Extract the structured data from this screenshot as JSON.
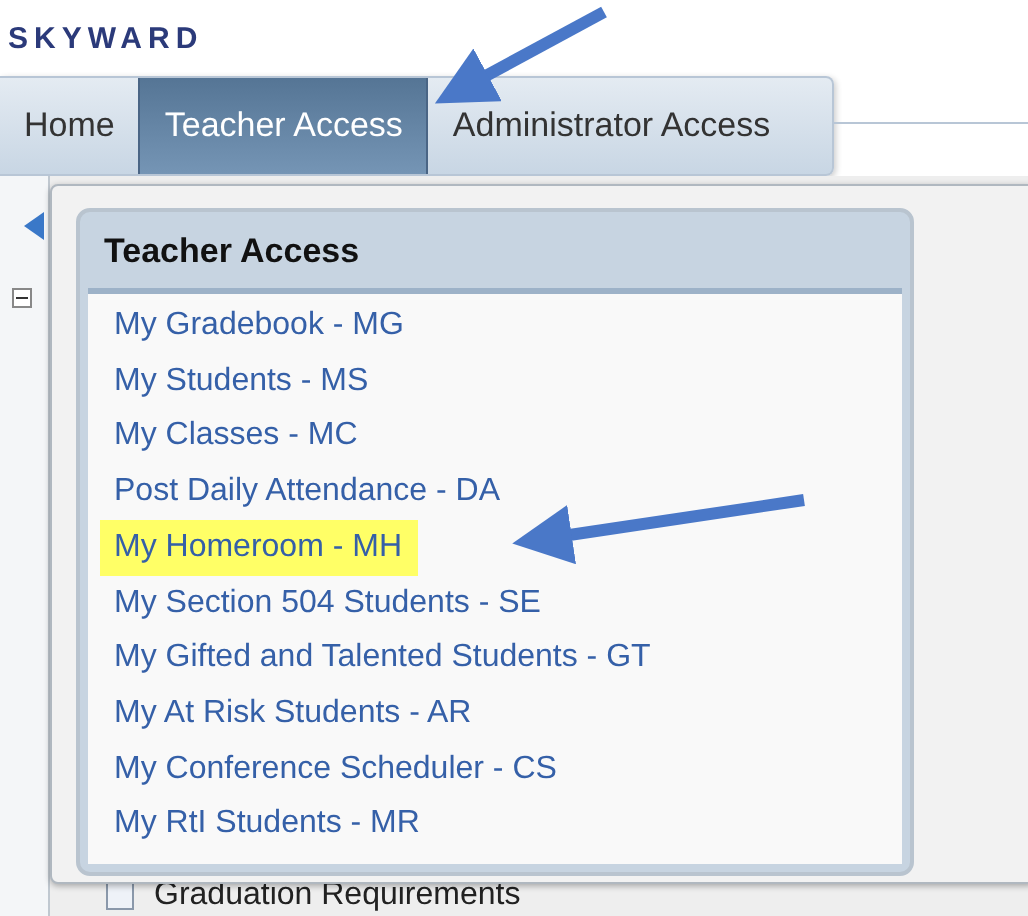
{
  "logo": {
    "text": "SKYWARD"
  },
  "tabs": [
    {
      "label": "Home",
      "selected": false
    },
    {
      "label": "Teacher Access",
      "selected": true
    },
    {
      "label": "Administrator Access",
      "selected": false
    }
  ],
  "menu": {
    "title": "Teacher Access",
    "items": [
      {
        "label": "My Gradebook - MG",
        "highlighted": false
      },
      {
        "label": "My Students - MS",
        "highlighted": false
      },
      {
        "label": "My Classes - MC",
        "highlighted": false
      },
      {
        "label": "Post Daily Attendance - DA",
        "highlighted": false
      },
      {
        "label": "My Homeroom - MH",
        "highlighted": true
      },
      {
        "label": "My Section 504 Students - SE",
        "highlighted": false
      },
      {
        "label": "My Gifted and Talented Students - GT",
        "highlighted": false
      },
      {
        "label": "My At Risk Students - AR",
        "highlighted": false
      },
      {
        "label": "My Conference Scheduler - CS",
        "highlighted": false
      },
      {
        "label": "My RtI Students - MR",
        "highlighted": false
      }
    ]
  },
  "background_items": [
    {
      "label": "Graduation Requirements",
      "checked": false
    }
  ]
}
